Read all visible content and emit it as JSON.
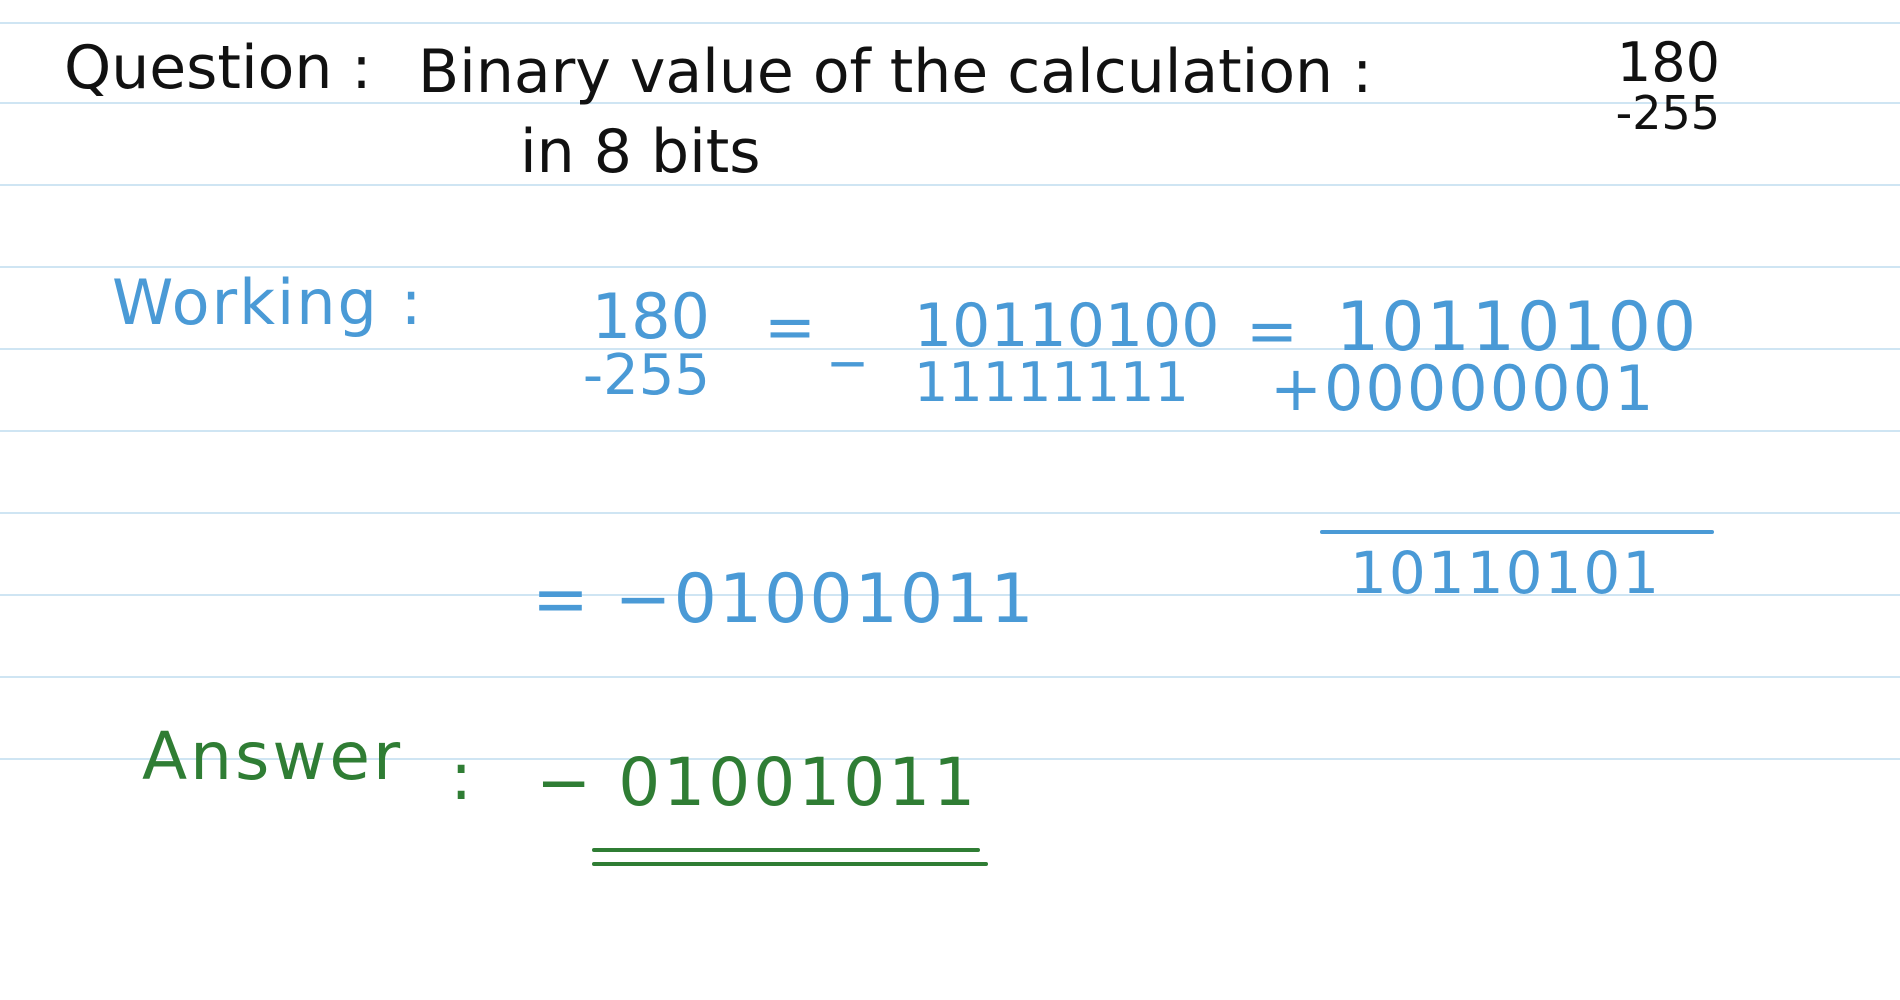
{
  "colors": {
    "background": "#ffffff",
    "rule_lines": "#cfe5f3",
    "question_ink": "#111111",
    "working_ink": "#4a9ad6",
    "answer_ink": "#2f7d34"
  },
  "question": {
    "label": "Question :",
    "line1": "Binary value of the calculation :",
    "numerator": "180",
    "denominator": "-255",
    "line2": "in 8 bits"
  },
  "working": {
    "label": "Working :",
    "numerator": "180",
    "denominator": "-255",
    "eq1": "=",
    "minus": "_",
    "bin_num": "10110100",
    "bin_den": "11111111",
    "eq2": "=",
    "add_top": "10110100",
    "add_second": "+00000001",
    "add_result": "10110101",
    "result_line": "= −01001011"
  },
  "answer": {
    "label": "Answer",
    "colon": ":",
    "value": "− 01001011"
  }
}
